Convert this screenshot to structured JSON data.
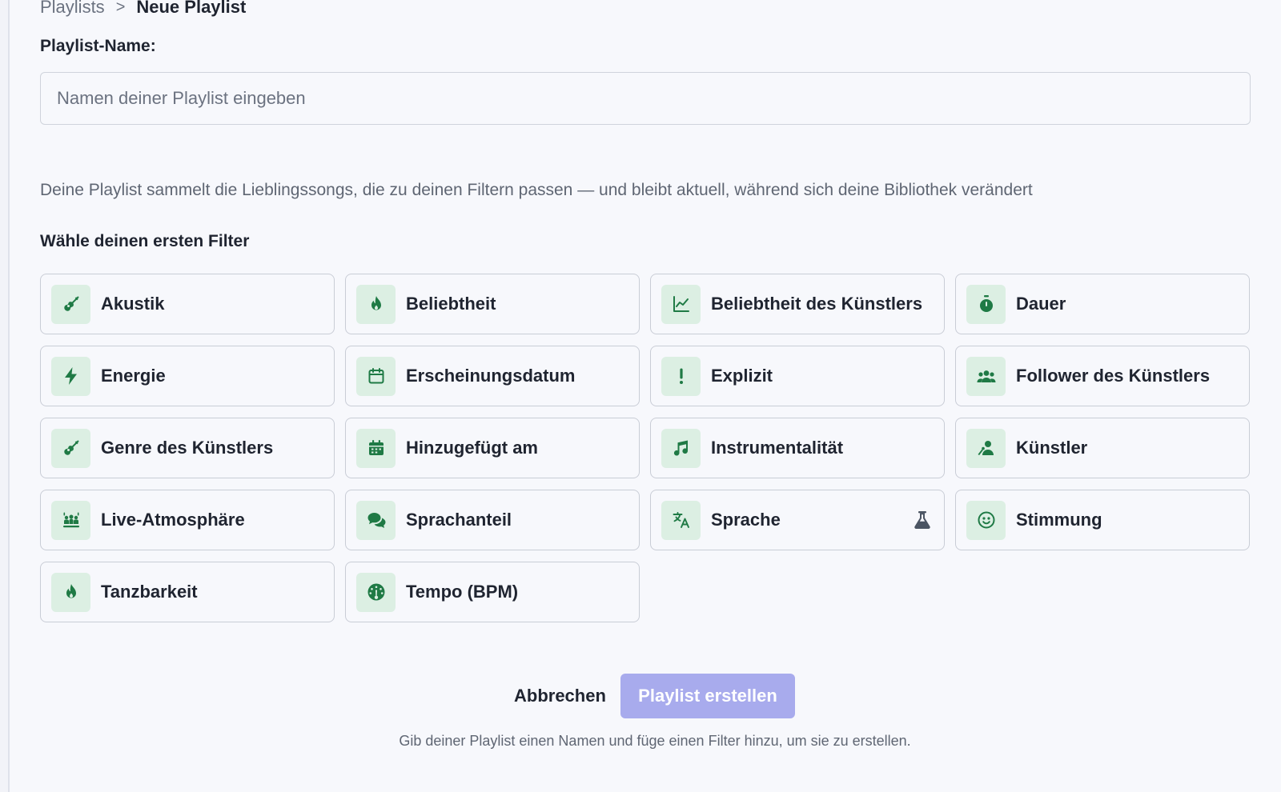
{
  "breadcrumb": {
    "parent": "Playlists",
    "separator": ">",
    "current": "Neue Playlist"
  },
  "form": {
    "name_label": "Playlist-Name:",
    "name_value": "",
    "name_placeholder": "Namen deiner Playlist eingeben",
    "description": "Deine Playlist sammelt die Lieblingssongs, die zu deinen Filtern passen — und bleibt aktuell, während sich deine Bibliothek verändert",
    "filter_heading": "Wähle deinen ersten Filter"
  },
  "colors": {
    "accent_green": "#1f7a45",
    "icon_bg": "#dcefe3",
    "primary_button_disabled": "#a8abed"
  },
  "filters": [
    {
      "label": "Akustik",
      "icon": "guitar-icon"
    },
    {
      "label": "Beliebtheit",
      "icon": "flame-icon"
    },
    {
      "label": "Beliebtheit des Künstlers",
      "icon": "chart-line-icon"
    },
    {
      "label": "Dauer",
      "icon": "stopwatch-icon"
    },
    {
      "label": "Energie",
      "icon": "lightning-icon"
    },
    {
      "label": "Erscheinungsdatum",
      "icon": "calendar-outline-icon"
    },
    {
      "label": "Explizit",
      "icon": "exclamation-icon"
    },
    {
      "label": "Follower des Künstlers",
      "icon": "users-icon"
    },
    {
      "label": "Genre des Künstlers",
      "icon": "guitar-icon"
    },
    {
      "label": "Hinzugefügt am",
      "icon": "calendar-filled-icon"
    },
    {
      "label": "Instrumentalität",
      "icon": "music-note-icon"
    },
    {
      "label": "Künstler",
      "icon": "artist-icon"
    },
    {
      "label": "Live-Atmosphäre",
      "icon": "audience-icon"
    },
    {
      "label": "Sprachanteil",
      "icon": "chat-bubbles-icon"
    },
    {
      "label": "Sprache",
      "icon": "translate-icon",
      "beta_icon": "flask-icon"
    },
    {
      "label": "Stimmung",
      "icon": "smiley-icon"
    },
    {
      "label": "Tanzbarkeit",
      "icon": "flame-icon"
    },
    {
      "label": "Tempo (BPM)",
      "icon": "gauge-icon"
    }
  ],
  "actions": {
    "cancel_label": "Abbrechen",
    "create_label": "Playlist erstellen",
    "create_disabled": true,
    "hint": "Gib deiner Playlist einen Namen und füge einen Filter hinzu, um sie zu erstellen."
  }
}
